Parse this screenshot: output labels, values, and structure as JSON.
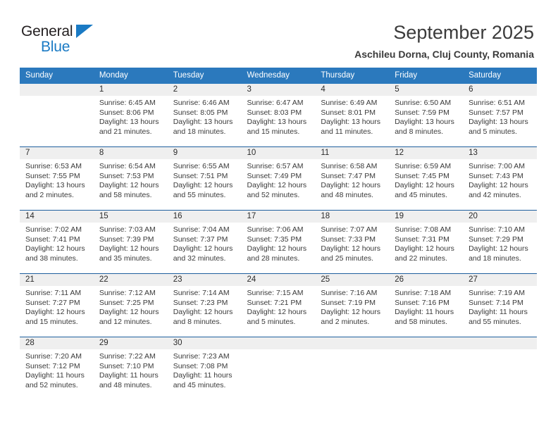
{
  "brand": {
    "line1": "General",
    "line2": "Blue",
    "triangle_color": "#1a7ac4",
    "text_color": "#231f20"
  },
  "header": {
    "title": "September 2025",
    "subtitle": "Aschileu Dorna, Cluj County, Romania"
  },
  "theme": {
    "header_blue": "#2b79bd",
    "separator_blue": "#1f5f9e",
    "daynum_gray": "#efefef"
  },
  "calendar": {
    "weekdays": [
      "Sunday",
      "Monday",
      "Tuesday",
      "Wednesday",
      "Thursday",
      "Friday",
      "Saturday"
    ],
    "weeks": [
      [
        {
          "day": "",
          "sunrise": "",
          "sunset": "",
          "daylight1": "",
          "daylight2": ""
        },
        {
          "day": "1",
          "sunrise": "Sunrise: 6:45 AM",
          "sunset": "Sunset: 8:06 PM",
          "daylight1": "Daylight: 13 hours",
          "daylight2": "and 21 minutes."
        },
        {
          "day": "2",
          "sunrise": "Sunrise: 6:46 AM",
          "sunset": "Sunset: 8:05 PM",
          "daylight1": "Daylight: 13 hours",
          "daylight2": "and 18 minutes."
        },
        {
          "day": "3",
          "sunrise": "Sunrise: 6:47 AM",
          "sunset": "Sunset: 8:03 PM",
          "daylight1": "Daylight: 13 hours",
          "daylight2": "and 15 minutes."
        },
        {
          "day": "4",
          "sunrise": "Sunrise: 6:49 AM",
          "sunset": "Sunset: 8:01 PM",
          "daylight1": "Daylight: 13 hours",
          "daylight2": "and 11 minutes."
        },
        {
          "day": "5",
          "sunrise": "Sunrise: 6:50 AM",
          "sunset": "Sunset: 7:59 PM",
          "daylight1": "Daylight: 13 hours",
          "daylight2": "and 8 minutes."
        },
        {
          "day": "6",
          "sunrise": "Sunrise: 6:51 AM",
          "sunset": "Sunset: 7:57 PM",
          "daylight1": "Daylight: 13 hours",
          "daylight2": "and 5 minutes."
        }
      ],
      [
        {
          "day": "7",
          "sunrise": "Sunrise: 6:53 AM",
          "sunset": "Sunset: 7:55 PM",
          "daylight1": "Daylight: 13 hours",
          "daylight2": "and 2 minutes."
        },
        {
          "day": "8",
          "sunrise": "Sunrise: 6:54 AM",
          "sunset": "Sunset: 7:53 PM",
          "daylight1": "Daylight: 12 hours",
          "daylight2": "and 58 minutes."
        },
        {
          "day": "9",
          "sunrise": "Sunrise: 6:55 AM",
          "sunset": "Sunset: 7:51 PM",
          "daylight1": "Daylight: 12 hours",
          "daylight2": "and 55 minutes."
        },
        {
          "day": "10",
          "sunrise": "Sunrise: 6:57 AM",
          "sunset": "Sunset: 7:49 PM",
          "daylight1": "Daylight: 12 hours",
          "daylight2": "and 52 minutes."
        },
        {
          "day": "11",
          "sunrise": "Sunrise: 6:58 AM",
          "sunset": "Sunset: 7:47 PM",
          "daylight1": "Daylight: 12 hours",
          "daylight2": "and 48 minutes."
        },
        {
          "day": "12",
          "sunrise": "Sunrise: 6:59 AM",
          "sunset": "Sunset: 7:45 PM",
          "daylight1": "Daylight: 12 hours",
          "daylight2": "and 45 minutes."
        },
        {
          "day": "13",
          "sunrise": "Sunrise: 7:00 AM",
          "sunset": "Sunset: 7:43 PM",
          "daylight1": "Daylight: 12 hours",
          "daylight2": "and 42 minutes."
        }
      ],
      [
        {
          "day": "14",
          "sunrise": "Sunrise: 7:02 AM",
          "sunset": "Sunset: 7:41 PM",
          "daylight1": "Daylight: 12 hours",
          "daylight2": "and 38 minutes."
        },
        {
          "day": "15",
          "sunrise": "Sunrise: 7:03 AM",
          "sunset": "Sunset: 7:39 PM",
          "daylight1": "Daylight: 12 hours",
          "daylight2": "and 35 minutes."
        },
        {
          "day": "16",
          "sunrise": "Sunrise: 7:04 AM",
          "sunset": "Sunset: 7:37 PM",
          "daylight1": "Daylight: 12 hours",
          "daylight2": "and 32 minutes."
        },
        {
          "day": "17",
          "sunrise": "Sunrise: 7:06 AM",
          "sunset": "Sunset: 7:35 PM",
          "daylight1": "Daylight: 12 hours",
          "daylight2": "and 28 minutes."
        },
        {
          "day": "18",
          "sunrise": "Sunrise: 7:07 AM",
          "sunset": "Sunset: 7:33 PM",
          "daylight1": "Daylight: 12 hours",
          "daylight2": "and 25 minutes."
        },
        {
          "day": "19",
          "sunrise": "Sunrise: 7:08 AM",
          "sunset": "Sunset: 7:31 PM",
          "daylight1": "Daylight: 12 hours",
          "daylight2": "and 22 minutes."
        },
        {
          "day": "20",
          "sunrise": "Sunrise: 7:10 AM",
          "sunset": "Sunset: 7:29 PM",
          "daylight1": "Daylight: 12 hours",
          "daylight2": "and 18 minutes."
        }
      ],
      [
        {
          "day": "21",
          "sunrise": "Sunrise: 7:11 AM",
          "sunset": "Sunset: 7:27 PM",
          "daylight1": "Daylight: 12 hours",
          "daylight2": "and 15 minutes."
        },
        {
          "day": "22",
          "sunrise": "Sunrise: 7:12 AM",
          "sunset": "Sunset: 7:25 PM",
          "daylight1": "Daylight: 12 hours",
          "daylight2": "and 12 minutes."
        },
        {
          "day": "23",
          "sunrise": "Sunrise: 7:14 AM",
          "sunset": "Sunset: 7:23 PM",
          "daylight1": "Daylight: 12 hours",
          "daylight2": "and 8 minutes."
        },
        {
          "day": "24",
          "sunrise": "Sunrise: 7:15 AM",
          "sunset": "Sunset: 7:21 PM",
          "daylight1": "Daylight: 12 hours",
          "daylight2": "and 5 minutes."
        },
        {
          "day": "25",
          "sunrise": "Sunrise: 7:16 AM",
          "sunset": "Sunset: 7:19 PM",
          "daylight1": "Daylight: 12 hours",
          "daylight2": "and 2 minutes."
        },
        {
          "day": "26",
          "sunrise": "Sunrise: 7:18 AM",
          "sunset": "Sunset: 7:16 PM",
          "daylight1": "Daylight: 11 hours",
          "daylight2": "and 58 minutes."
        },
        {
          "day": "27",
          "sunrise": "Sunrise: 7:19 AM",
          "sunset": "Sunset: 7:14 PM",
          "daylight1": "Daylight: 11 hours",
          "daylight2": "and 55 minutes."
        }
      ],
      [
        {
          "day": "28",
          "sunrise": "Sunrise: 7:20 AM",
          "sunset": "Sunset: 7:12 PM",
          "daylight1": "Daylight: 11 hours",
          "daylight2": "and 52 minutes."
        },
        {
          "day": "29",
          "sunrise": "Sunrise: 7:22 AM",
          "sunset": "Sunset: 7:10 PM",
          "daylight1": "Daylight: 11 hours",
          "daylight2": "and 48 minutes."
        },
        {
          "day": "30",
          "sunrise": "Sunrise: 7:23 AM",
          "sunset": "Sunset: 7:08 PM",
          "daylight1": "Daylight: 11 hours",
          "daylight2": "and 45 minutes."
        },
        {
          "day": "",
          "sunrise": "",
          "sunset": "",
          "daylight1": "",
          "daylight2": ""
        },
        {
          "day": "",
          "sunrise": "",
          "sunset": "",
          "daylight1": "",
          "daylight2": ""
        },
        {
          "day": "",
          "sunrise": "",
          "sunset": "",
          "daylight1": "",
          "daylight2": ""
        },
        {
          "day": "",
          "sunrise": "",
          "sunset": "",
          "daylight1": "",
          "daylight2": ""
        }
      ]
    ]
  }
}
